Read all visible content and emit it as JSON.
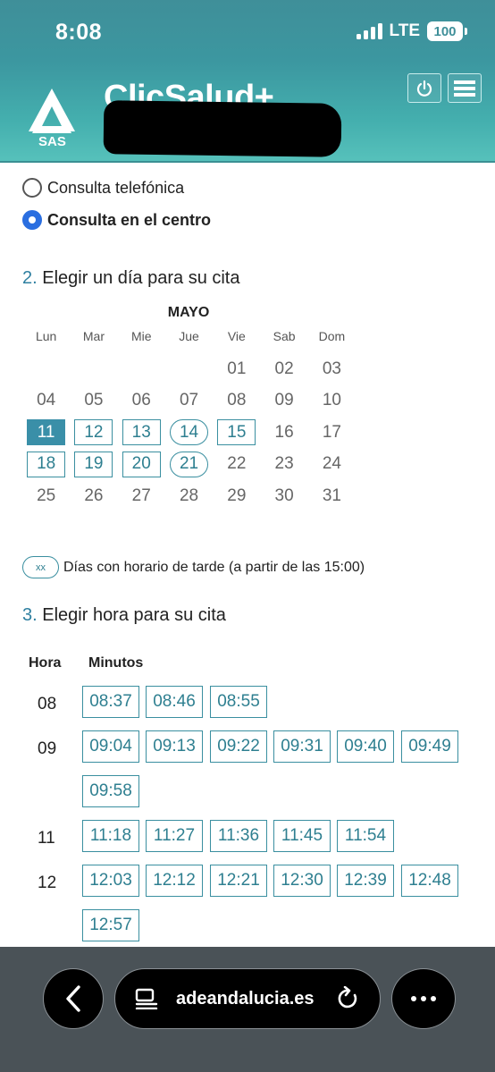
{
  "status_bar": {
    "time": "8:08",
    "network": "LTE",
    "battery": "100"
  },
  "header": {
    "logo_text": "SAS",
    "app_title": "ClicSalud+",
    "power_icon": "power-icon",
    "menu_icon": "hamburger-menu-icon"
  },
  "consult_type": {
    "options": [
      {
        "label": "Consulta telefónica",
        "selected": false
      },
      {
        "label": "Consulta en el centro",
        "selected": true
      }
    ]
  },
  "step2": {
    "number": "2.",
    "title": "Elegir un día para su cita"
  },
  "calendar": {
    "month": "MAYO",
    "weekdays": [
      "Lun",
      "Mar",
      "Mie",
      "Jue",
      "Vie",
      "Sab",
      "Dom"
    ],
    "days": [
      "",
      "",
      "",
      "",
      "01",
      "02",
      "03",
      "04",
      "05",
      "06",
      "07",
      "08",
      "09",
      "10",
      "11",
      "12",
      "13",
      "14",
      "15",
      "16",
      "17",
      "18",
      "19",
      "20",
      "21",
      "22",
      "23",
      "24",
      "25",
      "26",
      "27",
      "28",
      "29",
      "30",
      "31"
    ],
    "selected_day": "11",
    "available_days": [
      "12",
      "13",
      "15",
      "18",
      "19",
      "20"
    ],
    "afternoon_days": [
      "14",
      "21"
    ]
  },
  "legend": {
    "pill": "xx",
    "text": "Días con horario de tarde (a partir de las 15:00)"
  },
  "step3": {
    "number": "3.",
    "title": "Elegir hora para su cita"
  },
  "times": {
    "hour_header": "Hora",
    "minutes_header": "Minutos",
    "rows": [
      {
        "hour": "08",
        "slots": [
          "08:37",
          "08:46",
          "08:55"
        ]
      },
      {
        "hour": "09",
        "slots": [
          "09:04",
          "09:13",
          "09:22",
          "09:31",
          "09:40",
          "09:49",
          "09:58"
        ]
      },
      {
        "hour": "11",
        "slots": [
          "11:18",
          "11:27",
          "11:36",
          "11:45",
          "11:54"
        ]
      },
      {
        "hour": "12",
        "slots": [
          "12:03",
          "12:12",
          "12:21",
          "12:30",
          "12:39",
          "12:48",
          "12:57"
        ]
      }
    ]
  },
  "browser_toolbar": {
    "url": "adeandalucia.es",
    "back_icon": "back-chevron-icon",
    "page_icon": "page-format-icon",
    "reload_icon": "reload-icon",
    "more_icon": "more-icon"
  },
  "colors": {
    "accent": "#3a8fa0",
    "header": "#3f8f99",
    "radio_selected": "#2a6ee0"
  }
}
